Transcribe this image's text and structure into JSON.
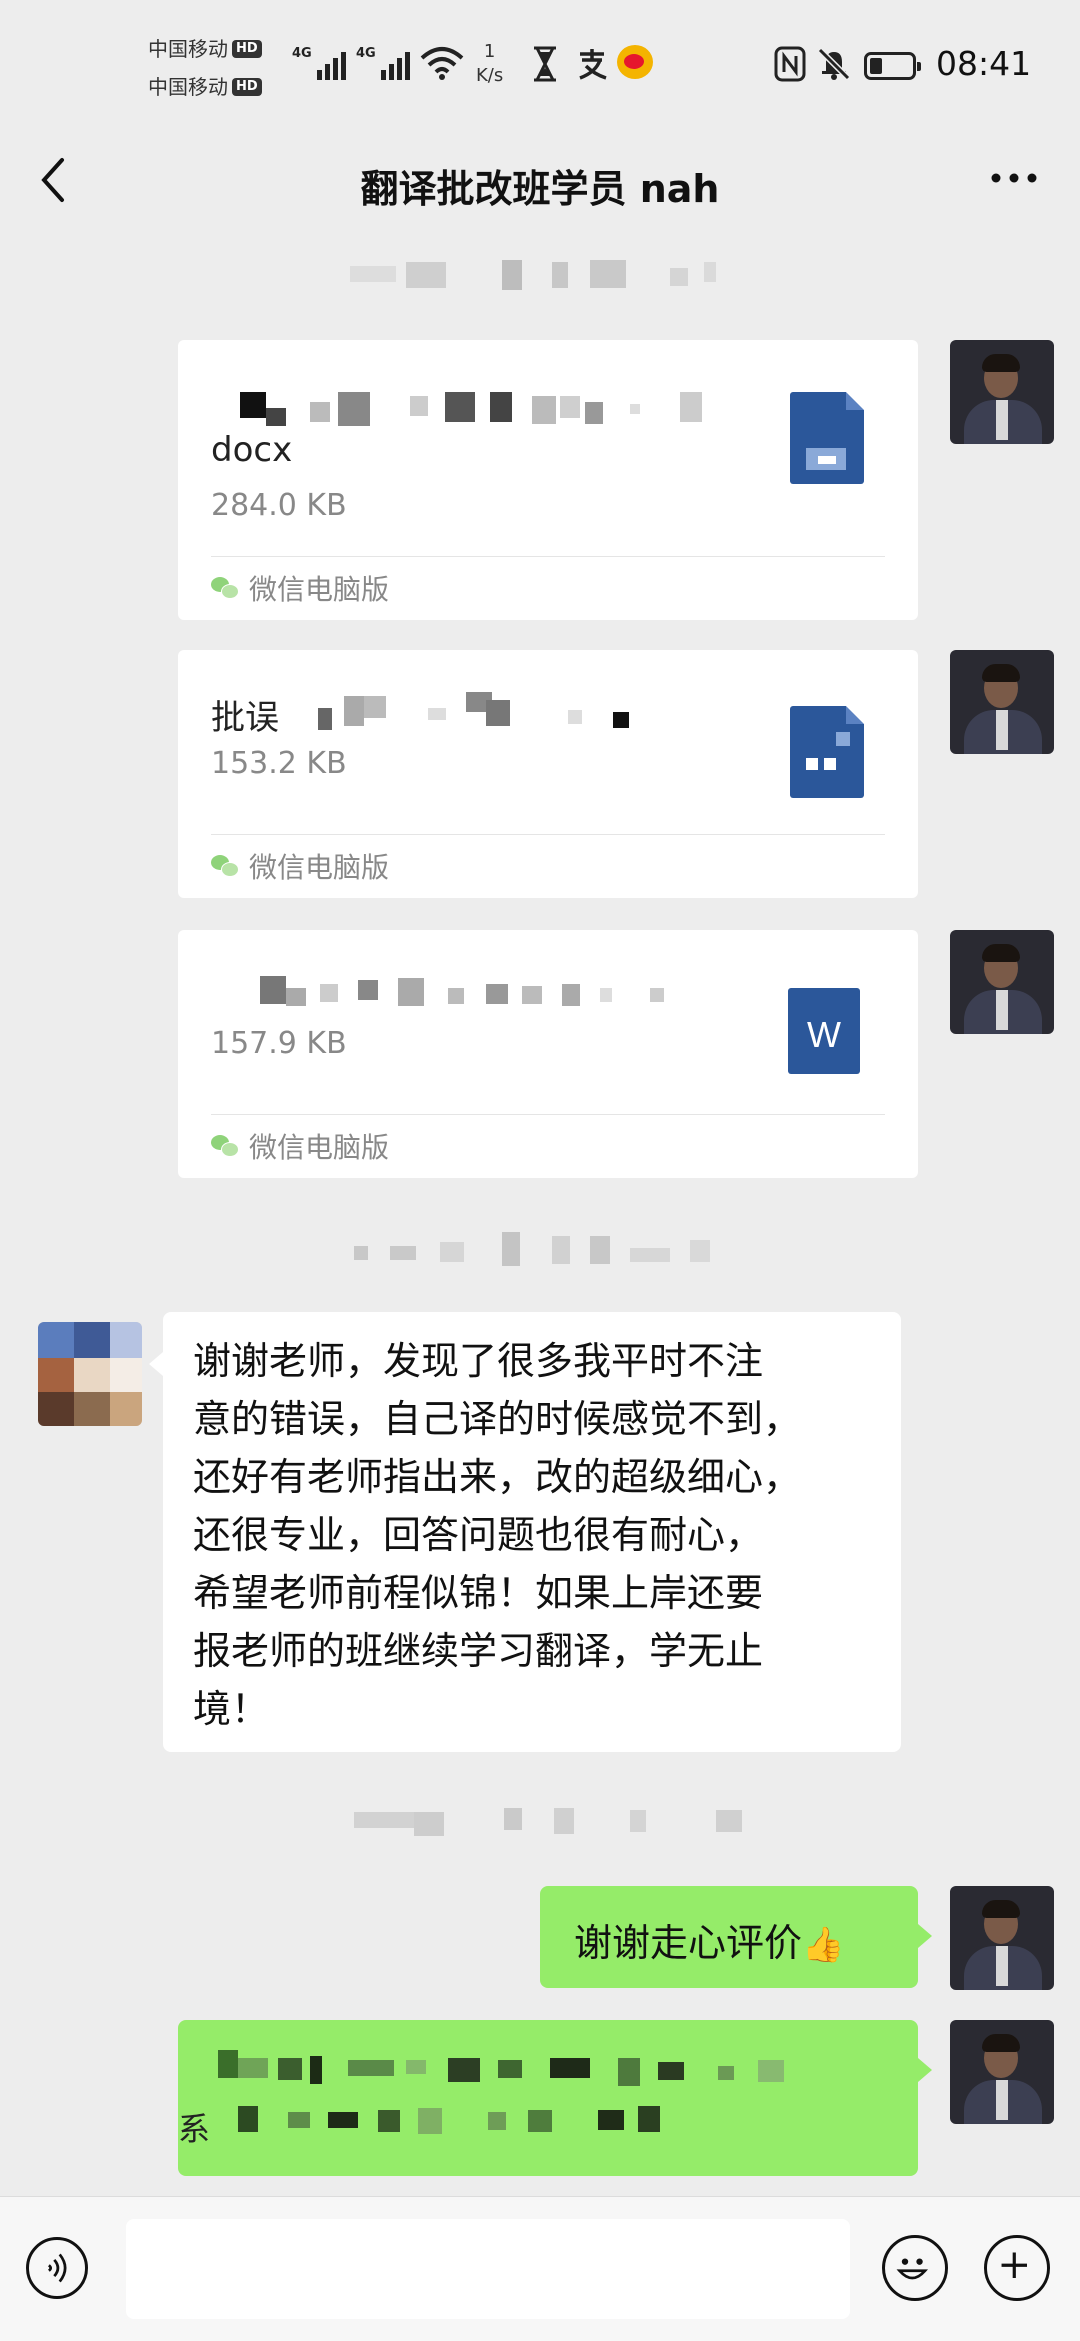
{
  "status_bar": {
    "carrier_1": "中国移动",
    "carrier_2": "中国移动",
    "hd_badge": "HD",
    "network_1": "4G",
    "network_2": "4G",
    "speed_value": "1",
    "speed_unit": "K/s",
    "time": "08:41",
    "icons": [
      "signal-icon",
      "wifi-icon",
      "hourglass-icon",
      "alipay-icon",
      "weibo-icon",
      "nfc-icon",
      "mute-icon",
      "battery-icon"
    ]
  },
  "header": {
    "title": "翻译批改班学员 nah",
    "back_icon": "chevron-left-icon",
    "more_icon": "more-icon"
  },
  "messages": {
    "file_1": {
      "name_suffix": "docx",
      "size": "284.0 KB",
      "source": "微信电脑版"
    },
    "file_2": {
      "name_prefix": "批误",
      "size": "153.2 KB",
      "source": "微信电脑版"
    },
    "file_3": {
      "size": "157.9 KB",
      "source": "微信电脑版",
      "icon_letter": "W"
    },
    "student_message": "谢谢老师，发现了很多我平时不注\n意的错误，自己译的时候感觉不到，\n还好有老师指出来，改的超级细心，\n还很专业，回答问题也很有耐心，\n希望老师前程似锦！如果上岸还要\n报老师的班继续学习翻译，学无止\n境！",
    "reply_1": "谢谢走心评价",
    "reply_1_emoji": "👍",
    "reply_2_visible_char": "系"
  },
  "input_bar": {
    "voice_icon": "voice-icon",
    "emoji_icon": "emoji-icon",
    "plus_icon": "plus-icon"
  },
  "colors": {
    "background": "#ededed",
    "bubble_green": "#95ec69",
    "word_blue": "#2b579a"
  }
}
